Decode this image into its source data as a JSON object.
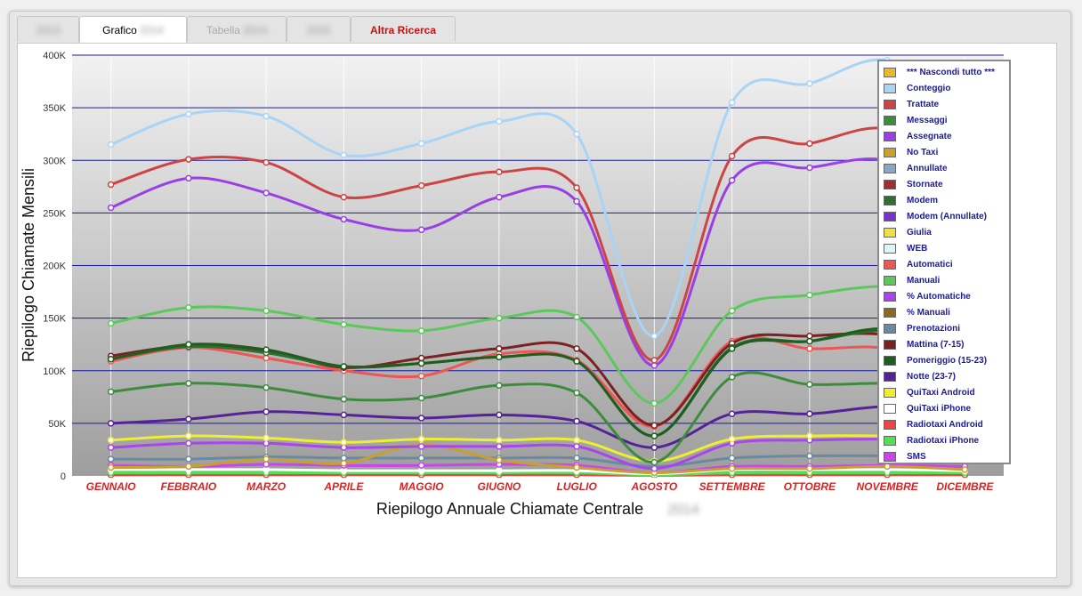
{
  "tabs": [
    {
      "label": "2013",
      "state": "blurred"
    },
    {
      "label": "Grafico",
      "suffix": "2014",
      "state": "active"
    },
    {
      "label": "Tabella",
      "suffix": "2014",
      "state": "inactive"
    },
    {
      "label": "2015",
      "state": "blurred"
    },
    {
      "label": "Altra Ricerca",
      "state": "link"
    }
  ],
  "chart_data": {
    "type": "line",
    "title": "",
    "xlabel": "Riepilogo Annuale Chiamate Centrale",
    "xlabel_suffix": "2014",
    "ylabel": "Riepilogo Chiamate Mensili",
    "ylim": [
      0,
      400000
    ],
    "yticks": [
      {
        "v": 0,
        "t": "0"
      },
      {
        "v": 50000,
        "t": "50K"
      },
      {
        "v": 100000,
        "t": "100K"
      },
      {
        "v": 150000,
        "t": "150K"
      },
      {
        "v": 200000,
        "t": "200K"
      },
      {
        "v": 250000,
        "t": "250K"
      },
      {
        "v": 300000,
        "t": "300K"
      },
      {
        "v": 350000,
        "t": "350K"
      },
      {
        "v": 400000,
        "t": "400K"
      }
    ],
    "grid": true,
    "legend_position": "top-right",
    "categories": [
      "GENNAIO",
      "FEBBRAIO",
      "MARZO",
      "APRILE",
      "MAGGIO",
      "GIUGNO",
      "LUGLIO",
      "AGOSTO",
      "SETTEMBRE",
      "OTTOBRE",
      "NOVEMBRE",
      "DICEMBRE"
    ],
    "series": [
      {
        "name": "*** Nascondi tutto ***",
        "color": "#e8b830",
        "values": null
      },
      {
        "name": "Conteggio",
        "color": "#a9d4f5",
        "values": [
          315000,
          344000,
          342000,
          305000,
          316000,
          337000,
          325000,
          133000,
          355000,
          373000,
          395000,
          345000
        ]
      },
      {
        "name": "Trattate",
        "color": "#cc4444",
        "values": [
          277000,
          301000,
          298000,
          265000,
          276000,
          289000,
          274000,
          110000,
          304000,
          316000,
          330000,
          290000
        ]
      },
      {
        "name": "Messaggi",
        "color": "#3d8c3d",
        "values": [
          80000,
          88000,
          84000,
          73000,
          74000,
          86000,
          79000,
          13000,
          94000,
          87000,
          88000,
          83000
        ]
      },
      {
        "name": "Assegnate",
        "color": "#9a3ee8",
        "values": [
          255000,
          283000,
          269000,
          244000,
          234000,
          265000,
          261000,
          105000,
          281000,
          293000,
          300000,
          264000
        ]
      },
      {
        "name": "No Taxi",
        "color": "#c8a030",
        "values": [
          8000,
          9000,
          16000,
          12000,
          30000,
          15000,
          8000,
          3000,
          7000,
          7000,
          9000,
          6000
        ]
      },
      {
        "name": "Annullate",
        "color": "#8aa6c2",
        "values": null
      },
      {
        "name": "Stornate",
        "color": "#a03030",
        "values": null
      },
      {
        "name": "Modem",
        "color": "#2e6e2e",
        "values": [
          111000,
          123000,
          117000,
          104000,
          107000,
          113000,
          109000,
          38000,
          122000,
          128000,
          138000,
          120000
        ]
      },
      {
        "name": "Modem (Annullate)",
        "color": "#7733cc",
        "values": null
      },
      {
        "name": "Giulia",
        "color": "#f0e040",
        "values": null
      },
      {
        "name": "WEB",
        "color": "#ddf6f6",
        "values": null
      },
      {
        "name": "Automatici",
        "color": "#ee5555",
        "values": [
          109000,
          122000,
          112000,
          100000,
          95000,
          116000,
          110000,
          47000,
          128000,
          121000,
          121000,
          96000
        ]
      },
      {
        "name": "Manuali",
        "color": "#5bc85b",
        "values": [
          145000,
          160000,
          157000,
          144000,
          138000,
          150000,
          151000,
          69000,
          157000,
          172000,
          180000,
          168000
        ]
      },
      {
        "name": "% Automatiche",
        "color": "#aa44ee",
        "values": [
          27000,
          31000,
          31000,
          27000,
          28000,
          28000,
          28000,
          7000,
          31000,
          34000,
          35000,
          33000
        ]
      },
      {
        "name": "% Manuali",
        "color": "#8a6a20",
        "values": null
      },
      {
        "name": "Prenotazioni",
        "color": "#6a8aa0",
        "values": [
          16000,
          16000,
          18000,
          17000,
          17000,
          17000,
          17000,
          9000,
          17000,
          19000,
          19000,
          17000
        ]
      },
      {
        "name": "Mattina (7-15)",
        "color": "#7a2222",
        "values": [
          114000,
          124000,
          119000,
          103000,
          112000,
          121000,
          121000,
          48000,
          126000,
          133000,
          134000,
          115000
        ]
      },
      {
        "name": "Pomeriggio (15-23)",
        "color": "#1e5e1e",
        "values": [
          111000,
          125000,
          120000,
          104000,
          107000,
          113000,
          109000,
          38000,
          121000,
          128000,
          140000,
          120000
        ]
      },
      {
        "name": "Notte (23-7)",
        "color": "#552299",
        "values": [
          50000,
          54000,
          61000,
          58000,
          55000,
          58000,
          52000,
          27000,
          59000,
          59000,
          66000,
          60000
        ]
      },
      {
        "name": "QuiTaxi Android",
        "color": "#eeee33",
        "values": [
          34000,
          38000,
          36000,
          32000,
          35000,
          34000,
          34000,
          14000,
          35000,
          38000,
          38000,
          36000
        ]
      },
      {
        "name": "QuiTaxi iPhone",
        "color": "#ffffff",
        "values": [
          6000,
          6000,
          6000,
          5000,
          5000,
          5000,
          5000,
          2000,
          6000,
          6000,
          6000,
          5000
        ]
      },
      {
        "name": "Radiotaxi Android",
        "color": "#ee4444",
        "values": [
          1000,
          1000,
          1000,
          1000,
          1000,
          1000,
          1000,
          500,
          1000,
          1000,
          1000,
          1000
        ]
      },
      {
        "name": "Radiotaxi iPhone",
        "color": "#55dd55",
        "values": [
          3000,
          3000,
          3000,
          3000,
          3000,
          3000,
          3000,
          1000,
          3000,
          3000,
          3000,
          3000
        ]
      },
      {
        "name": "SMS",
        "color": "#cc44ee",
        "values": [
          10000,
          9000,
          11000,
          10000,
          10000,
          11000,
          10000,
          3000,
          9000,
          9000,
          10000,
          9000
        ]
      }
    ]
  }
}
